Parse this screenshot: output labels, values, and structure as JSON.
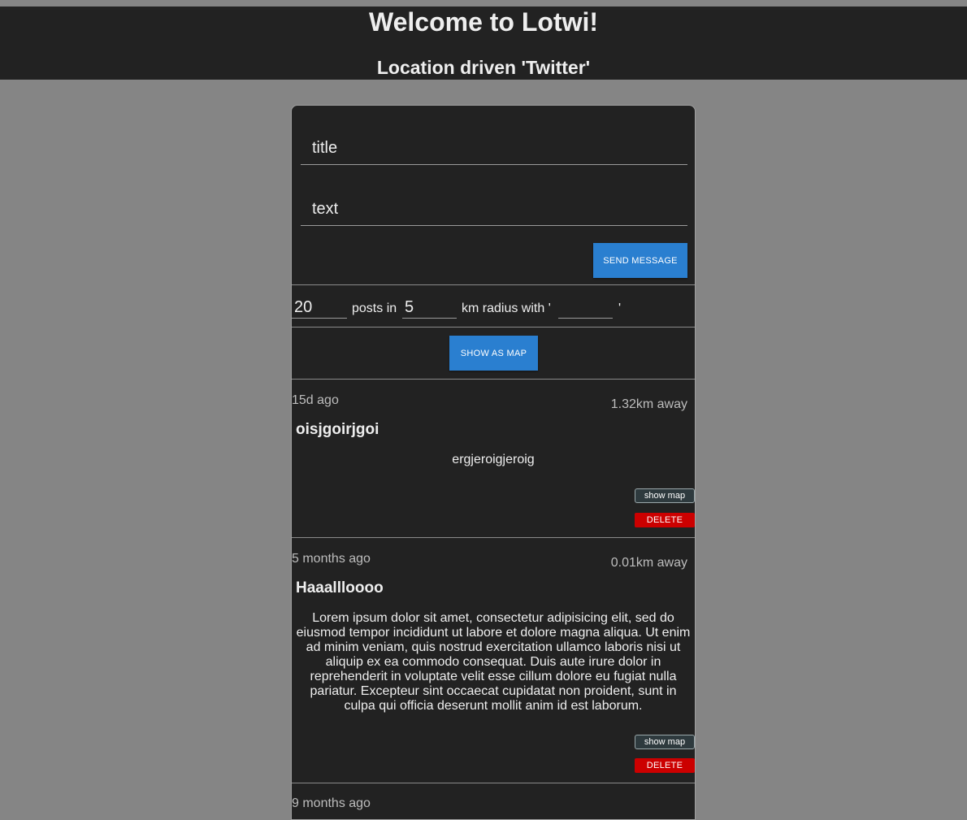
{
  "header": {
    "title": "Welcome to Lotwi!",
    "subtitle": "Location driven 'Twitter'"
  },
  "compose": {
    "title_placeholder": "title",
    "text_placeholder": "text",
    "send_label": "SEND MESSAGE"
  },
  "filter": {
    "count_value": "20",
    "posts_in_label": "posts in",
    "radius_value": "5",
    "radius_label": "km radius with '",
    "keyword_value": "",
    "close_quote": "'"
  },
  "show_as_map_label": "SHOW AS MAP",
  "posts": [
    {
      "ago": "15d ago",
      "distance": "1.32km away",
      "title": "oisjgoirjgoi",
      "body": "ergjeroigjeroig",
      "show_map_label": "show map",
      "delete_label": "DELETE"
    },
    {
      "ago": "5 months ago",
      "distance": "0.01km away",
      "title": "Haaallloooo",
      "body": "Lorem ipsum dolor sit amet, consectetur adipisicing elit, sed do eiusmod tempor incididunt ut labore et dolore magna aliqua. Ut enim ad minim veniam, quis nostrud exercitation ullamco laboris nisi ut aliquip ex ea commodo consequat. Duis aute irure dolor in reprehenderit in voluptate velit esse cillum dolore eu fugiat nulla pariatur. Excepteur sint occaecat cupidatat non proident, sunt in culpa qui officia deserunt mollit anim id est laborum.",
      "show_map_label": "show map",
      "delete_label": "DELETE"
    },
    {
      "ago": "9 months ago"
    }
  ],
  "colors": {
    "background": "#858585",
    "panel": "#222222",
    "accent": "#2a7fd0",
    "delete": "#cc0000"
  }
}
